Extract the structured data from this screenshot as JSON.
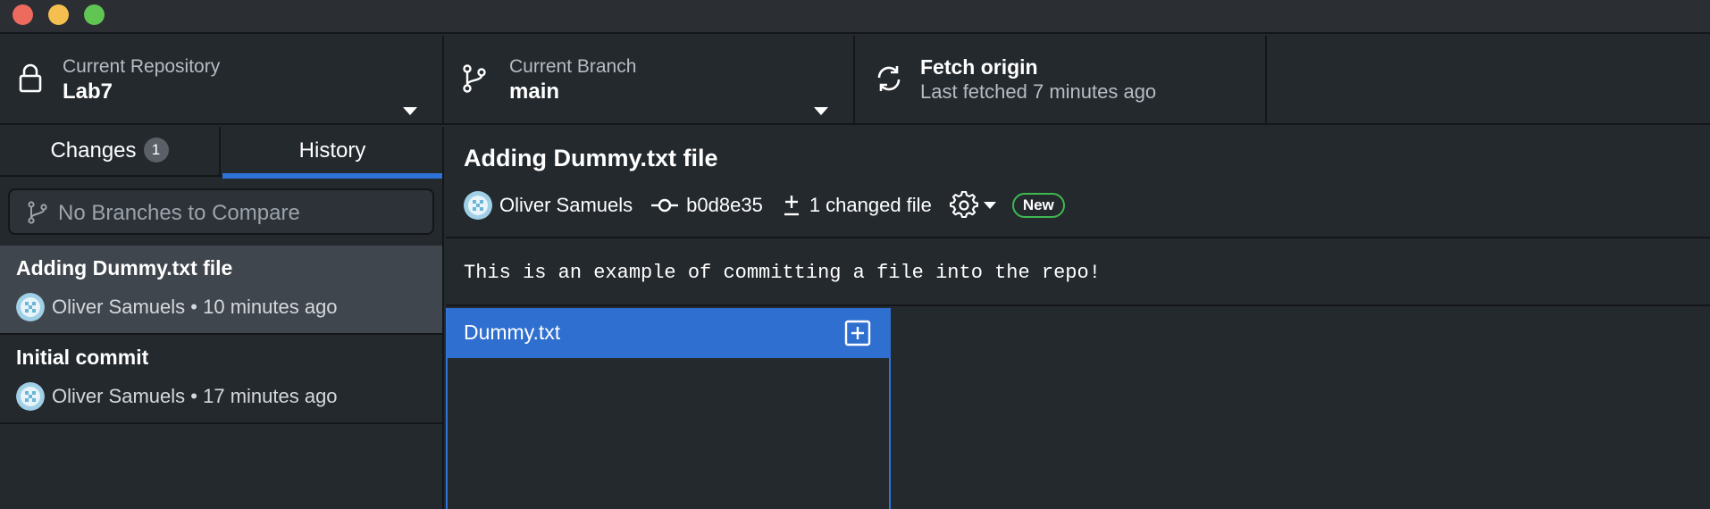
{
  "toolbar": {
    "repository": {
      "label": "Current Repository",
      "value": "Lab7",
      "icon": "lock-icon"
    },
    "branch": {
      "label": "Current Branch",
      "value": "main",
      "icon": "git-branch-icon"
    },
    "fetch": {
      "label": "Fetch origin",
      "value": "Last fetched 7 minutes ago",
      "icon": "sync-icon"
    }
  },
  "sidebar": {
    "tabs": [
      {
        "label": "Changes",
        "count": "1"
      },
      {
        "label": "History"
      }
    ],
    "compare_placeholder": "No Branches to Compare",
    "commits": [
      {
        "title": "Adding Dummy.txt file",
        "author": "Oliver Samuels",
        "separator": "•",
        "time": "10 minutes ago"
      },
      {
        "title": "Initial commit",
        "author": "Oliver Samuels",
        "separator": "•",
        "time": "17 minutes ago"
      }
    ]
  },
  "commit": {
    "title": "Adding Dummy.txt file",
    "author": "Oliver Samuels",
    "sha": "b0d8e35",
    "changed_files": "1 changed file",
    "new_badge": "New",
    "message": "This is an example of committing a file into the repo!"
  },
  "files": [
    {
      "name": "Dummy.txt",
      "status_icon": "file-added-icon"
    }
  ],
  "colors": {
    "background": "#24292e",
    "accent": "#2f73d8",
    "selected_row": "#40464d",
    "new_badge_border": "#3fb950"
  }
}
